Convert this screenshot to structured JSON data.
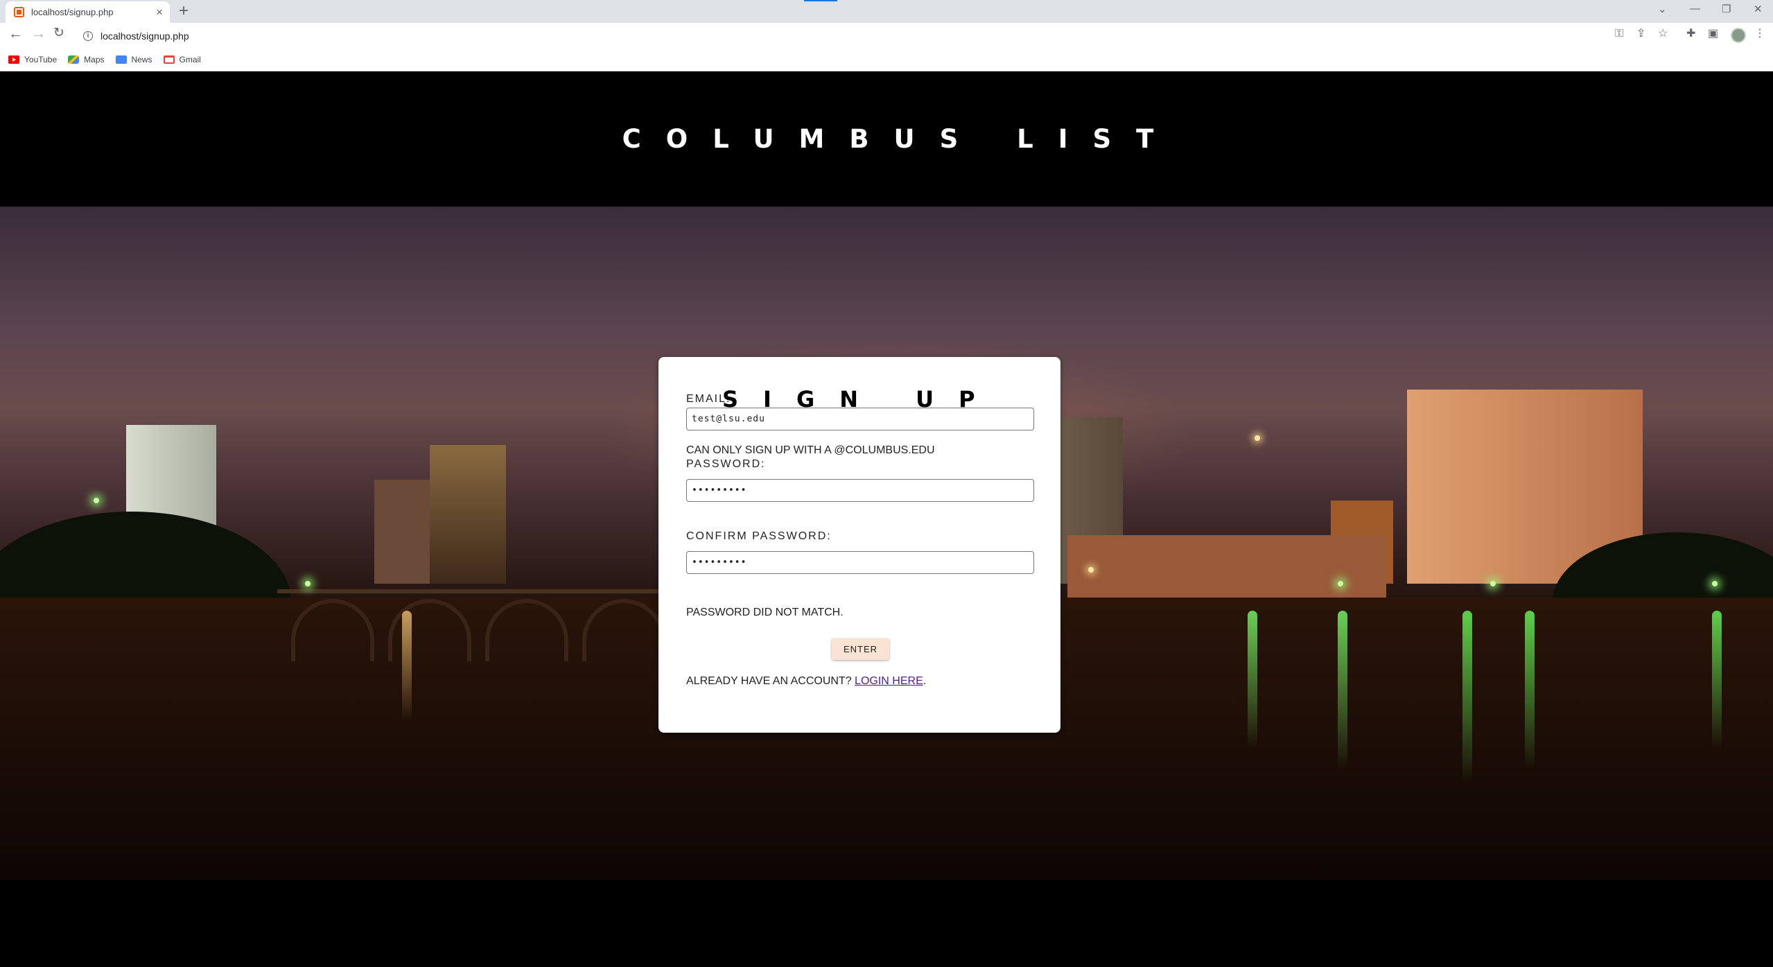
{
  "browser": {
    "tab_title": "localhost/signup.php",
    "tab_close": "×",
    "new_tab": "+",
    "url": "localhost/signup.php",
    "bookmarks": [
      {
        "label": "YouTube"
      },
      {
        "label": "Maps"
      },
      {
        "label": "News"
      },
      {
        "label": "Gmail"
      }
    ]
  },
  "site": {
    "title": "COLUMBUS LIST"
  },
  "signup": {
    "heading": "SIGN UP",
    "email_label": "EMAIL:",
    "email_value": "test@lsu.edu",
    "email_note": "CAN ONLY SIGN UP WITH A @COLUMBUS.EDU",
    "password_label": "PASSWORD:",
    "password_value": "•••••••••",
    "confirm_label": "CONFIRM PASSWORD:",
    "confirm_value": "•••••••••",
    "error_message": "PASSWORD DID NOT MATCH.",
    "submit_label": "ENTER",
    "login_prompt": "ALREADY HAVE AN ACCOUNT?",
    "login_link": "LOGIN HERE",
    "login_suffix": "."
  }
}
